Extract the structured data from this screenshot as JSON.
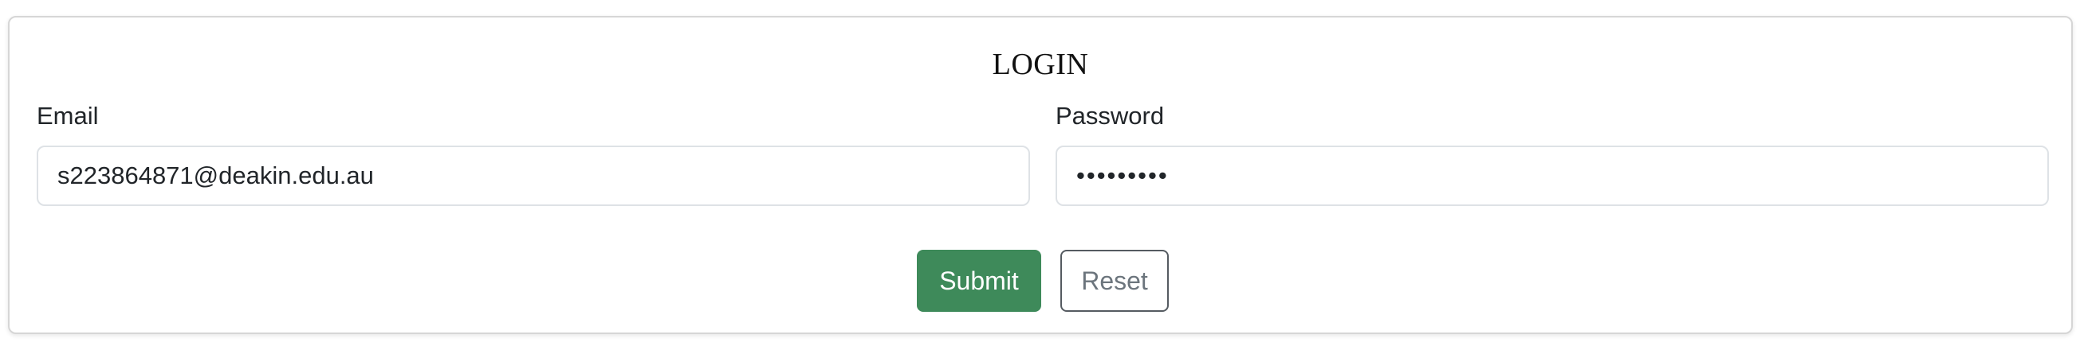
{
  "form": {
    "title": "LOGIN",
    "email": {
      "label": "Email",
      "value": "s223864871@deakin.edu.au"
    },
    "password": {
      "label": "Password",
      "value": "•••••••••"
    },
    "buttons": {
      "submit_label": "Submit",
      "reset_label": "Reset"
    }
  },
  "colors": {
    "submit_background": "#3e8a5a",
    "reset_border": "#555b61",
    "reset_text": "#6c757d"
  }
}
